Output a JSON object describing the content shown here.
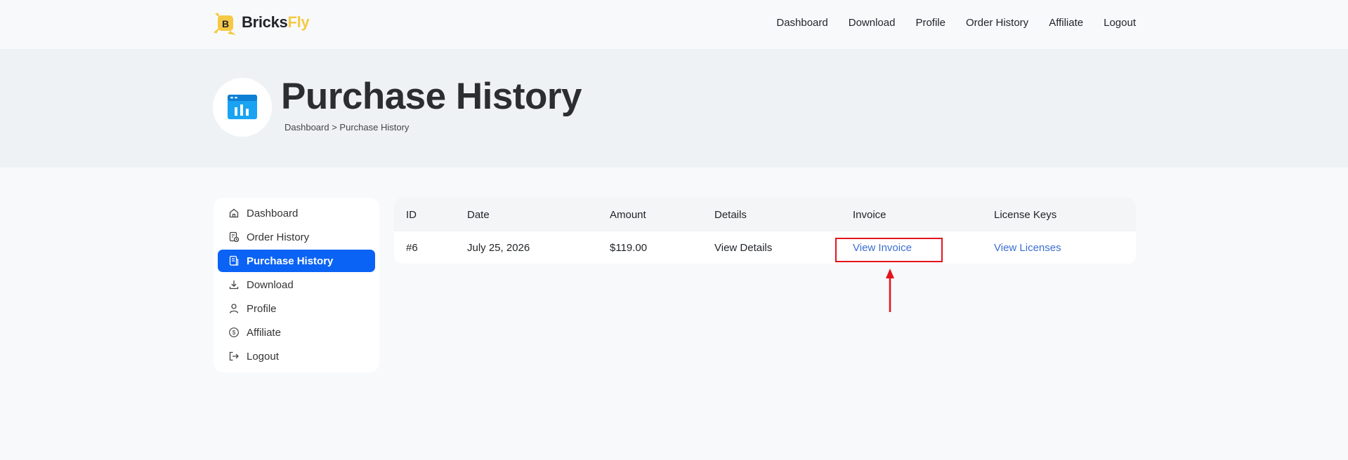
{
  "brand": {
    "name_part1": "Bricks",
    "name_part2": "Fly",
    "mark_letter": "B"
  },
  "nav": [
    "Dashboard",
    "Download",
    "Profile",
    "Order History",
    "Affiliate",
    "Logout"
  ],
  "hero": {
    "title": "Purchase History",
    "breadcrumb": "Dashboard > Purchase History",
    "icon": "chart-window-icon"
  },
  "sidebar": {
    "items": [
      {
        "label": "Dashboard",
        "icon": "home-icon",
        "active": false
      },
      {
        "label": "Order History",
        "icon": "order-history-icon",
        "active": false
      },
      {
        "label": "Purchase History",
        "icon": "receipt-icon",
        "active": true
      },
      {
        "label": "Download",
        "icon": "download-icon",
        "active": false
      },
      {
        "label": "Profile",
        "icon": "user-icon",
        "active": false
      },
      {
        "label": "Affiliate",
        "icon": "dollar-icon",
        "active": false
      },
      {
        "label": "Logout",
        "icon": "logout-icon",
        "active": false
      }
    ]
  },
  "table": {
    "headers": [
      "ID",
      "Date",
      "Amount",
      "Details",
      "Invoice",
      "License Keys"
    ],
    "rows": [
      {
        "id": "#6",
        "date": "July 25, 2026",
        "amount": "$119.00",
        "details": "View Details",
        "invoice": "View Invoice",
        "licenses": "View Licenses"
      }
    ]
  },
  "colors": {
    "accent": "#0b63f5",
    "link": "#3b6fd1",
    "brand_yellow": "#f6c945",
    "annotation_red": "#e3141b"
  }
}
